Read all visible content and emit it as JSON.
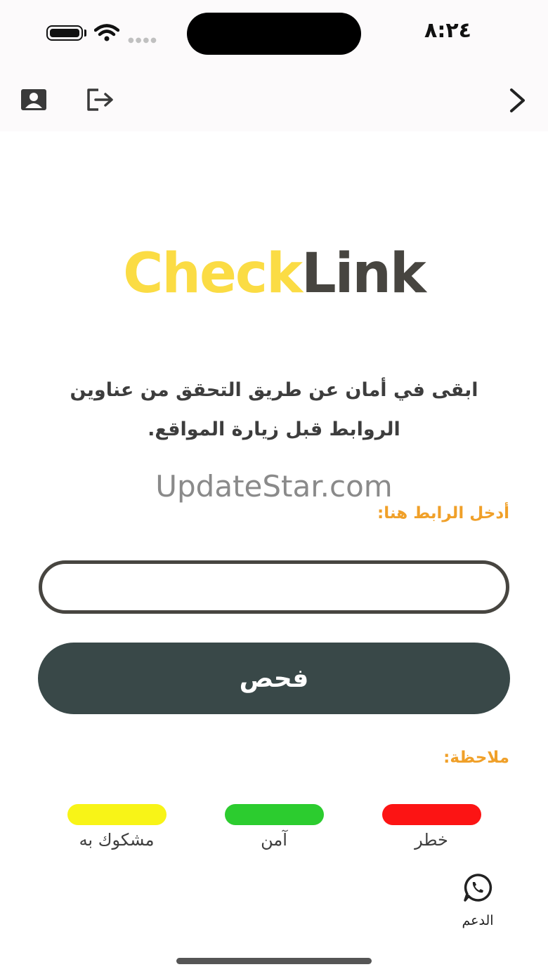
{
  "status_bar": {
    "time": "٨:٢٤"
  },
  "toolbar": {
    "profile_icon": "person-card-icon",
    "logout_icon": "logout-icon",
    "next_icon": "chevron-right-icon"
  },
  "logo": {
    "part1": "Check",
    "part2": "Link",
    "color1": "#fbdc44",
    "color2": "#474540"
  },
  "tagline": "ابقى في أمان عن طريق التحقق من عناوين الروابط قبل زيارة المواقع.",
  "watermark": "UpdateStar.com",
  "form": {
    "url_label": "أدخل الرابط هنا:",
    "url_value": "",
    "url_placeholder": "",
    "check_button": "فحص"
  },
  "note": {
    "label": "ملاحظة:",
    "legend": [
      {
        "label": "خطر",
        "color": "#fc1414"
      },
      {
        "label": "آمن",
        "color": "#2ccc2f"
      },
      {
        "label": "مشكوك به",
        "color": "#f8f417"
      }
    ]
  },
  "support": {
    "icon": "whatsapp-icon",
    "label": "الدعم"
  }
}
